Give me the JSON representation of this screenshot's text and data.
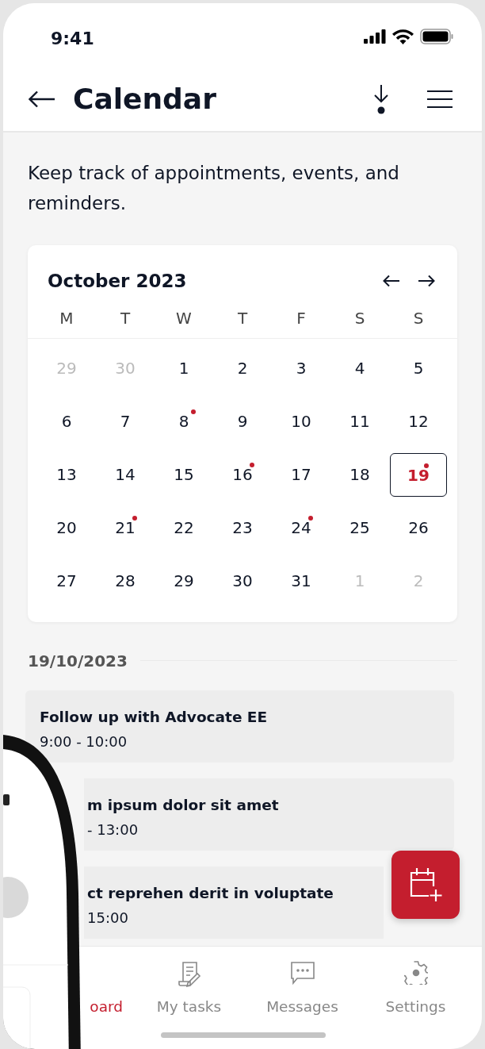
{
  "status_bar": {
    "time": "9:41"
  },
  "header": {
    "title": "Calendar"
  },
  "description": "Keep track of appointments, events, and reminders.",
  "calendar": {
    "month": "October 2023",
    "weekdays": [
      "M",
      "T",
      "W",
      "T",
      "F",
      "S",
      "S"
    ],
    "weeks": [
      [
        {
          "day": "29",
          "muted": true,
          "event": false,
          "selected": false
        },
        {
          "day": "30",
          "muted": true,
          "event": false,
          "selected": false
        },
        {
          "day": "1",
          "muted": false,
          "event": false,
          "selected": false
        },
        {
          "day": "2",
          "muted": false,
          "event": false,
          "selected": false
        },
        {
          "day": "3",
          "muted": false,
          "event": false,
          "selected": false
        },
        {
          "day": "4",
          "muted": false,
          "event": false,
          "selected": false
        },
        {
          "day": "5",
          "muted": false,
          "event": false,
          "selected": false
        }
      ],
      [
        {
          "day": "6",
          "muted": false,
          "event": false,
          "selected": false
        },
        {
          "day": "7",
          "muted": false,
          "event": false,
          "selected": false
        },
        {
          "day": "8",
          "muted": false,
          "event": true,
          "selected": false
        },
        {
          "day": "9",
          "muted": false,
          "event": false,
          "selected": false
        },
        {
          "day": "10",
          "muted": false,
          "event": false,
          "selected": false
        },
        {
          "day": "11",
          "muted": false,
          "event": false,
          "selected": false
        },
        {
          "day": "12",
          "muted": false,
          "event": false,
          "selected": false
        }
      ],
      [
        {
          "day": "13",
          "muted": false,
          "event": false,
          "selected": false
        },
        {
          "day": "14",
          "muted": false,
          "event": false,
          "selected": false
        },
        {
          "day": "15",
          "muted": false,
          "event": false,
          "selected": false
        },
        {
          "day": "16",
          "muted": false,
          "event": true,
          "selected": false
        },
        {
          "day": "17",
          "muted": false,
          "event": false,
          "selected": false
        },
        {
          "day": "18",
          "muted": false,
          "event": false,
          "selected": false
        },
        {
          "day": "19",
          "muted": false,
          "event": true,
          "selected": true
        }
      ],
      [
        {
          "day": "20",
          "muted": false,
          "event": false,
          "selected": false
        },
        {
          "day": "21",
          "muted": false,
          "event": true,
          "selected": false
        },
        {
          "day": "22",
          "muted": false,
          "event": false,
          "selected": false
        },
        {
          "day": "23",
          "muted": false,
          "event": false,
          "selected": false
        },
        {
          "day": "24",
          "muted": false,
          "event": true,
          "selected": false
        },
        {
          "day": "25",
          "muted": false,
          "event": false,
          "selected": false
        },
        {
          "day": "26",
          "muted": false,
          "event": false,
          "selected": false
        }
      ],
      [
        {
          "day": "27",
          "muted": false,
          "event": false,
          "selected": false
        },
        {
          "day": "28",
          "muted": false,
          "event": false,
          "selected": false
        },
        {
          "day": "29",
          "muted": false,
          "event": false,
          "selected": false
        },
        {
          "day": "30",
          "muted": false,
          "event": false,
          "selected": false
        },
        {
          "day": "31",
          "muted": false,
          "event": false,
          "selected": false
        },
        {
          "day": "1",
          "muted": true,
          "event": false,
          "selected": false
        },
        {
          "day": "2",
          "muted": true,
          "event": false,
          "selected": false
        }
      ]
    ]
  },
  "date_heading": "19/10/2023",
  "events": [
    {
      "title": "Follow up with Advocate EE",
      "time": "9:00 - 10:00",
      "obscured": false
    },
    {
      "title": "m ipsum dolor sit amet",
      "time": "- 13:00",
      "obscured": true
    },
    {
      "title": "ct reprehen derit in voluptate",
      "time": "15:00",
      "obscured": true
    }
  ],
  "bottom_nav": [
    {
      "kind": "home",
      "label": "oard",
      "selected": true,
      "obscured": true
    },
    {
      "kind": "tasks",
      "label": "My tasks",
      "selected": false,
      "obscured": false
    },
    {
      "kind": "messages",
      "label": "Messages",
      "selected": false,
      "obscured": false
    },
    {
      "kind": "settings",
      "label": "Settings",
      "selected": false,
      "obscured": false
    }
  ]
}
